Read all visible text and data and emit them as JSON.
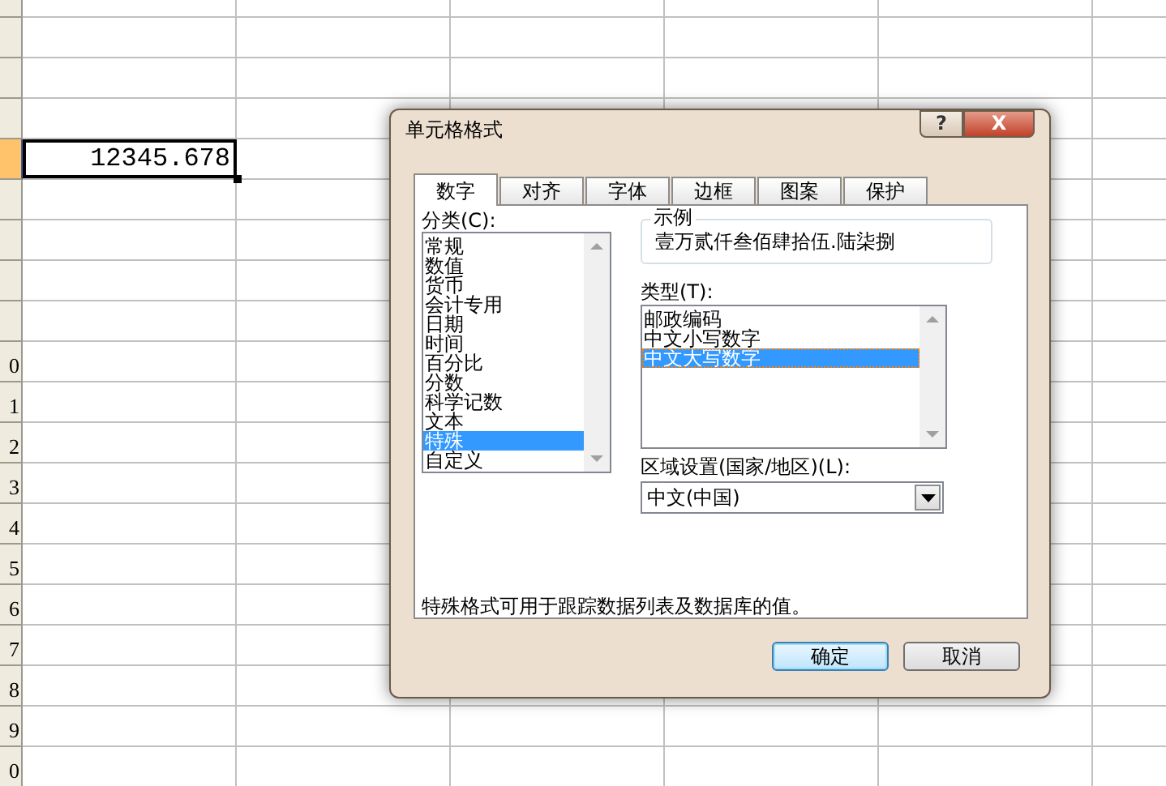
{
  "sheet": {
    "rows": [
      {
        "selected": false
      },
      {
        "selected": false
      },
      {
        "selected": false
      },
      {
        "selected": false
      },
      {
        "selected": true,
        "cell": "12345.678"
      },
      {
        "selected": false
      },
      {
        "selected": false
      },
      {
        "selected": false
      },
      {
        "selected": false
      },
      {
        "selected": false,
        "label": "0"
      },
      {
        "selected": false,
        "label": "1"
      },
      {
        "selected": false,
        "label": "2"
      },
      {
        "selected": false,
        "label": "3"
      },
      {
        "selected": false,
        "label": "4"
      },
      {
        "selected": false,
        "label": "5"
      },
      {
        "selected": false,
        "label": "6"
      },
      {
        "selected": false,
        "label": "7"
      },
      {
        "selected": false,
        "label": "8"
      },
      {
        "selected": false,
        "label": "9"
      },
      {
        "selected": false,
        "label": "0"
      }
    ]
  },
  "dialog": {
    "title": "单元格格式",
    "help": "?",
    "close": "X",
    "tabs": [
      {
        "label": "数字",
        "selected": true
      },
      {
        "label": "对齐",
        "selected": false
      },
      {
        "label": "字体",
        "selected": false
      },
      {
        "label": "边框",
        "selected": false
      },
      {
        "label": "图案",
        "selected": false
      },
      {
        "label": "保护",
        "selected": false
      }
    ],
    "category_label": "分类(C):",
    "categories": [
      {
        "label": "常规",
        "selected": false
      },
      {
        "label": "数值",
        "selected": false
      },
      {
        "label": "货币",
        "selected": false
      },
      {
        "label": "会计专用",
        "selected": false
      },
      {
        "label": "日期",
        "selected": false
      },
      {
        "label": "时间",
        "selected": false
      },
      {
        "label": "百分比",
        "selected": false
      },
      {
        "label": "分数",
        "selected": false
      },
      {
        "label": "科学记数",
        "selected": false
      },
      {
        "label": "文本",
        "selected": false
      },
      {
        "label": "特殊",
        "selected": true
      },
      {
        "label": "自定义",
        "selected": false
      }
    ],
    "sample": {
      "label": "示例",
      "value": "壹万贰仟叁佰肆拾伍.陆柒捌"
    },
    "type_label": "类型(T):",
    "types": [
      {
        "label": "邮政编码",
        "selected": false
      },
      {
        "label": "中文小写数字",
        "selected": false
      },
      {
        "label": "中文大写数字",
        "selected": true
      }
    ],
    "locale_label": "区域设置(国家/地区)(L):",
    "locale_value": "中文(中国)",
    "description": "特殊格式可用于跟踪数据列表及数据库的值。",
    "buttons": [
      {
        "label": "确定",
        "default": true
      },
      {
        "label": "取消",
        "default": false
      }
    ]
  }
}
